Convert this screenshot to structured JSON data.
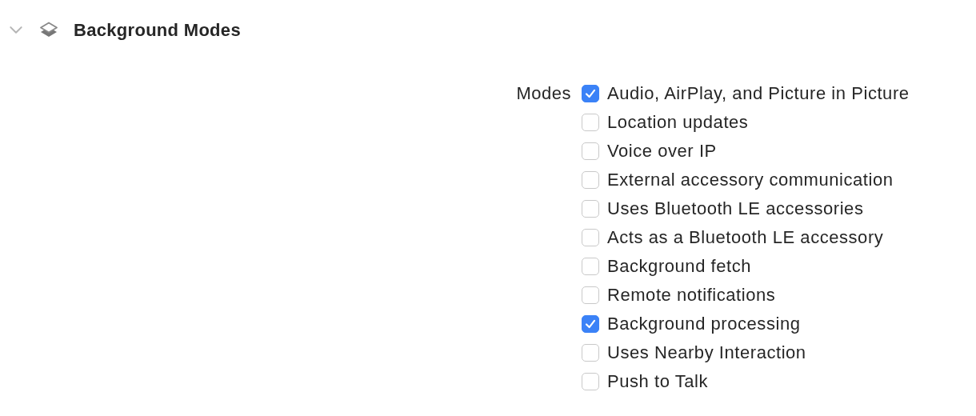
{
  "section": {
    "title": "Background Modes",
    "expanded": true
  },
  "modes": {
    "label": "Modes",
    "options": [
      {
        "label": "Audio, AirPlay, and Picture in Picture",
        "checked": true
      },
      {
        "label": "Location updates",
        "checked": false
      },
      {
        "label": "Voice over IP",
        "checked": false
      },
      {
        "label": "External accessory communication",
        "checked": false
      },
      {
        "label": "Uses Bluetooth LE accessories",
        "checked": false
      },
      {
        "label": "Acts as a Bluetooth LE accessory",
        "checked": false
      },
      {
        "label": "Background fetch",
        "checked": false
      },
      {
        "label": "Remote notifications",
        "checked": false
      },
      {
        "label": "Background processing",
        "checked": true
      },
      {
        "label": "Uses Nearby Interaction",
        "checked": false
      },
      {
        "label": "Push to Talk",
        "checked": false
      }
    ]
  }
}
